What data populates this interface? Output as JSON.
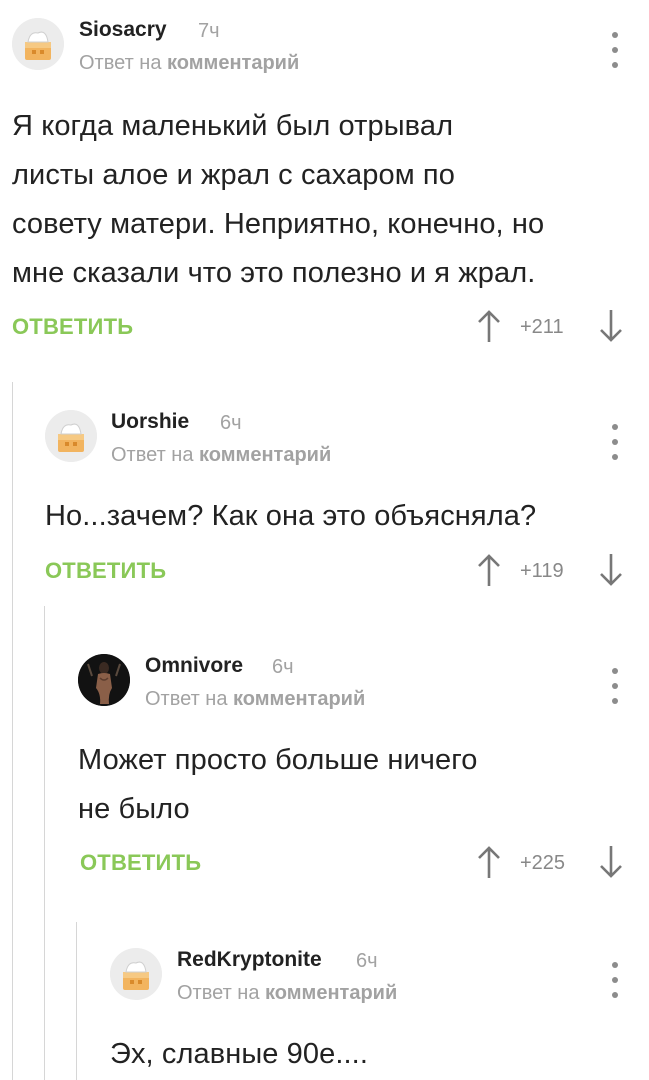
{
  "reply_prefix": "Ответ на",
  "reply_target": "комментарий",
  "reply_button": "ОТВЕТИТЬ",
  "colors": {
    "accent": "#8ac858",
    "muted": "#a2a2a2",
    "thread_line": "#d6d6d6"
  },
  "comments": [
    {
      "username": "Siosacry",
      "time": "7ч",
      "avatar": "default-avatar-icon",
      "lines": [
        "Я когда маленький был отрывал",
        "листы алое и жрал с сахаром по",
        "совету матери. Неприятно, конечно, но",
        "мне сказали что это полезно и я жрал."
      ],
      "rating": "+211"
    },
    {
      "username": "Uorshie",
      "time": "6ч",
      "avatar": "default-avatar-icon",
      "lines": [
        "Но...зачем? Как она это объясняла?"
      ],
      "rating": "+119"
    },
    {
      "username": "Omnivore",
      "time": "6ч",
      "avatar": "user-photo-avatar",
      "lines": [
        "Может просто больше ничего",
        "не было"
      ],
      "rating": "+225"
    },
    {
      "username": "RedKryptonite",
      "time": "6ч",
      "avatar": "default-avatar-icon",
      "lines": [
        "Эх, славные 90е...."
      ],
      "rating": ""
    }
  ]
}
